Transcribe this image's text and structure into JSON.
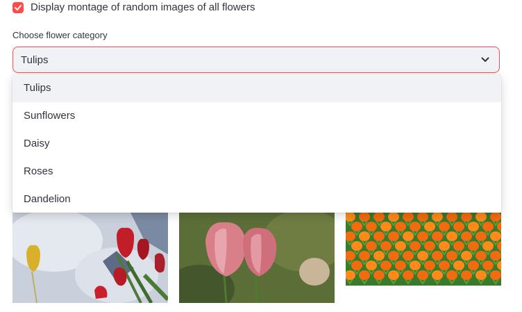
{
  "checkbox": {
    "label": "Display montage of random images of all flowers",
    "checked": true
  },
  "select": {
    "label": "Choose flower category",
    "value": "Tulips",
    "options": [
      "Tulips",
      "Sunflowers",
      "Daisy",
      "Roses",
      "Dandelion"
    ]
  },
  "colors": {
    "accent": "#ff4b4b",
    "text": "#31333f",
    "field_bg": "#f0f2f6"
  },
  "icons": {
    "check": "check-icon",
    "chevron": "chevron-down-icon"
  }
}
